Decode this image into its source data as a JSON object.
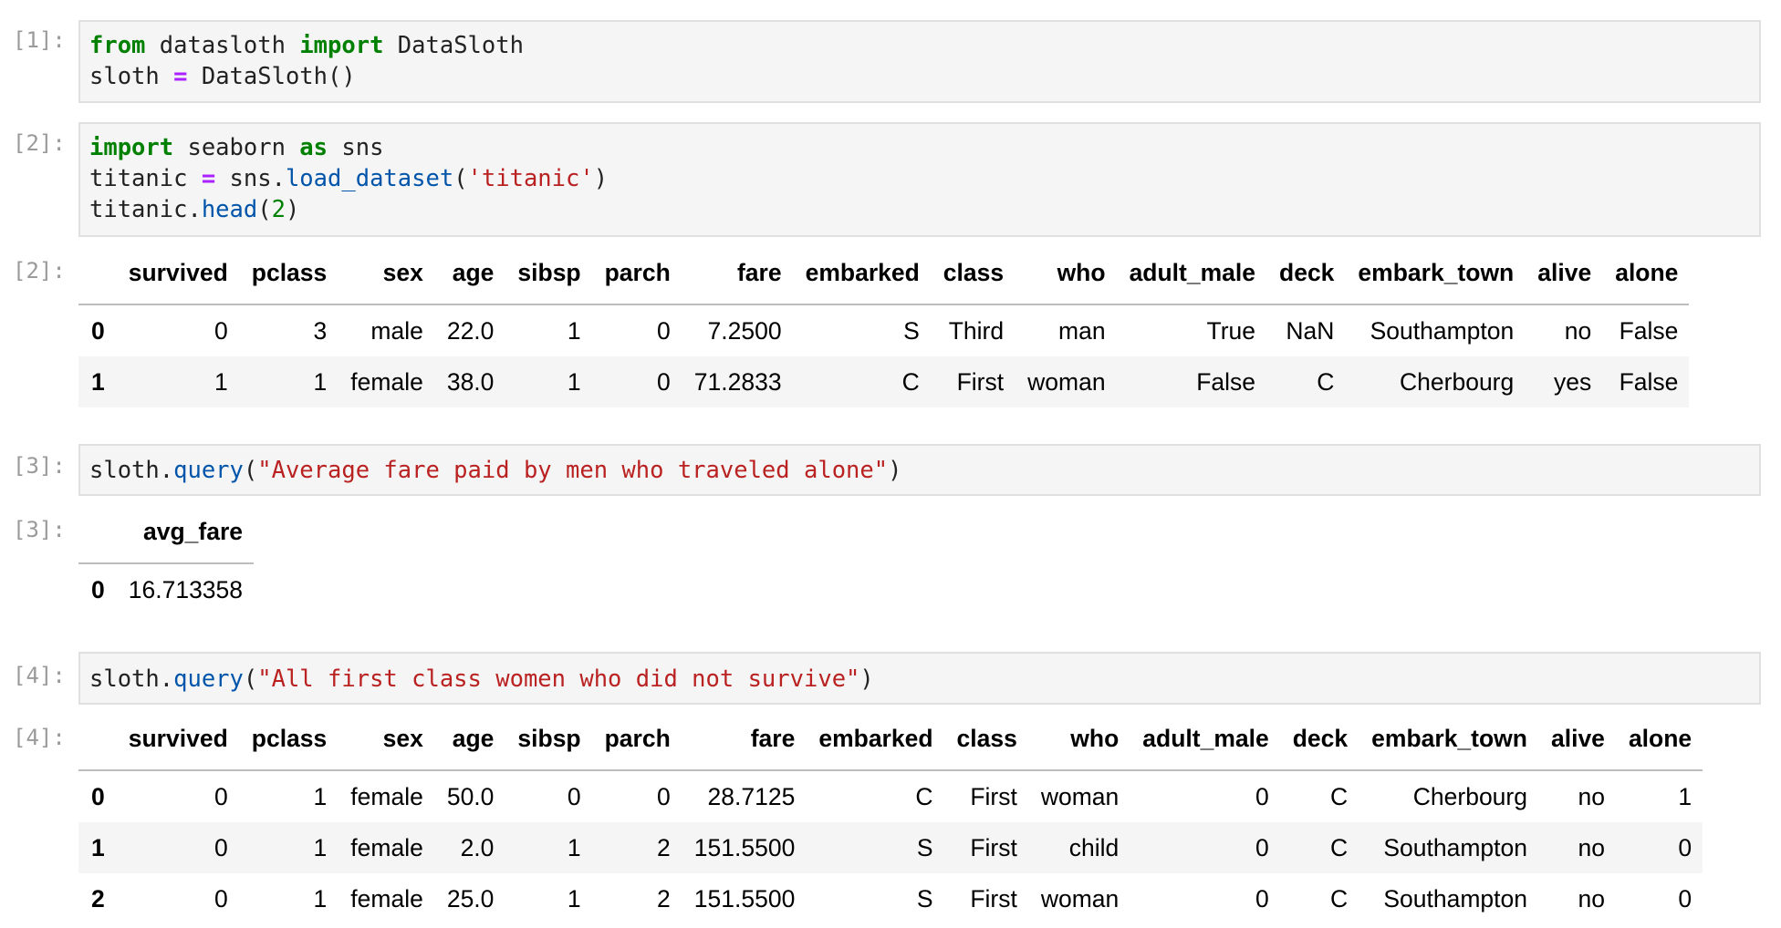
{
  "cells": [
    {
      "prompt": "[1]:",
      "lines": [
        [
          [
            "kw",
            "from"
          ],
          [
            "",
            "  datasloth "
          ],
          [
            "kw",
            "import"
          ],
          [
            "",
            " DataSloth"
          ]
        ],
        [
          [
            "",
            "sloth "
          ],
          [
            "op",
            "="
          ],
          [
            "",
            " DataSloth()"
          ]
        ]
      ]
    },
    {
      "prompt": "[2]:",
      "lines": [
        [
          [
            "kw",
            "import"
          ],
          [
            "",
            " seaborn "
          ],
          [
            "kw",
            "as"
          ],
          [
            "",
            " sns"
          ]
        ],
        [
          [
            "",
            "titanic "
          ],
          [
            "op",
            "="
          ],
          [
            "",
            " sns."
          ],
          [
            "fn",
            "load_dataset"
          ],
          [
            "",
            "("
          ],
          [
            "str",
            "'titanic'"
          ],
          [
            "",
            ")"
          ]
        ],
        [
          [
            "",
            "titanic."
          ],
          [
            "fn",
            "head"
          ],
          [
            "",
            "("
          ],
          [
            "num",
            "2"
          ],
          [
            "",
            ")"
          ]
        ]
      ]
    },
    {
      "prompt": "[3]:",
      "lines": [
        [
          [
            "",
            "sloth."
          ],
          [
            "fn",
            "query"
          ],
          [
            "",
            "("
          ],
          [
            "str",
            "\"Average fare paid by men who traveled alone\""
          ],
          [
            "",
            ")"
          ]
        ]
      ]
    },
    {
      "prompt": "[4]:",
      "lines": [
        [
          [
            "",
            "sloth."
          ],
          [
            "fn",
            "query"
          ],
          [
            "",
            "("
          ],
          [
            "str",
            "\"All first class women who did not survive\""
          ],
          [
            "",
            ")"
          ]
        ]
      ]
    }
  ],
  "outputs": [
    {
      "prompt": "[2]:",
      "columns": [
        "",
        "survived",
        "pclass",
        "sex",
        "age",
        "sibsp",
        "parch",
        "fare",
        "embarked",
        "class",
        "who",
        "adult_male",
        "deck",
        "embark_town",
        "alive",
        "alone"
      ],
      "rows": [
        [
          "0",
          "0",
          "3",
          "male",
          "22.0",
          "1",
          "0",
          "7.2500",
          "S",
          "Third",
          "man",
          "True",
          "NaN",
          "Southampton",
          "no",
          "False"
        ],
        [
          "1",
          "1",
          "1",
          "female",
          "38.0",
          "1",
          "0",
          "71.2833",
          "C",
          "First",
          "woman",
          "False",
          "C",
          "Cherbourg",
          "yes",
          "False"
        ]
      ]
    },
    {
      "prompt": "[3]:",
      "columns": [
        "",
        "avg_fare"
      ],
      "rows": [
        [
          "0",
          "16.713358"
        ]
      ]
    },
    {
      "prompt": "[4]:",
      "columns": [
        "",
        "survived",
        "pclass",
        "sex",
        "age",
        "sibsp",
        "parch",
        "fare",
        "embarked",
        "class",
        "who",
        "adult_male",
        "deck",
        "embark_town",
        "alive",
        "alone"
      ],
      "rows": [
        [
          "0",
          "0",
          "1",
          "female",
          "50.0",
          "0",
          "0",
          "28.7125",
          "C",
          "First",
          "woman",
          "0",
          "C",
          "Cherbourg",
          "no",
          "1"
        ],
        [
          "1",
          "0",
          "1",
          "female",
          "2.0",
          "1",
          "2",
          "151.5500",
          "S",
          "First",
          "child",
          "0",
          "C",
          "Southampton",
          "no",
          "0"
        ],
        [
          "2",
          "0",
          "1",
          "female",
          "25.0",
          "1",
          "2",
          "151.5500",
          "S",
          "First",
          "woman",
          "0",
          "C",
          "Southampton",
          "no",
          "0"
        ]
      ]
    }
  ]
}
